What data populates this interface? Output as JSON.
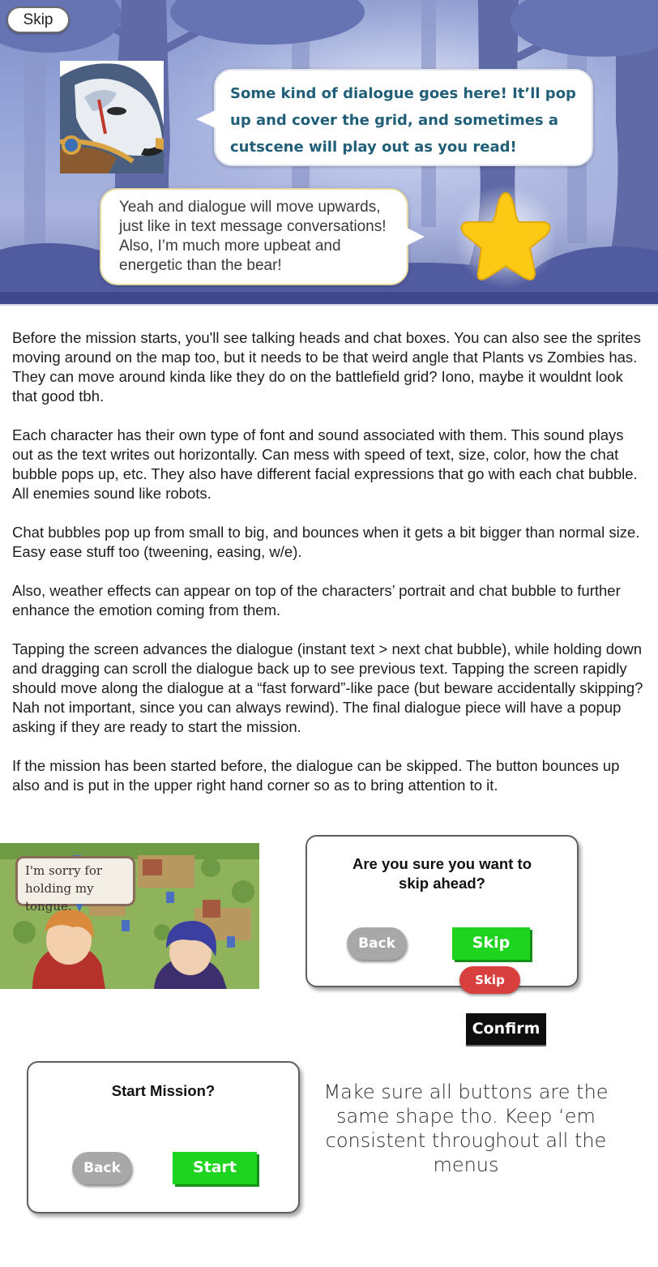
{
  "hero": {
    "skip_label": "Skip",
    "bear_line": "Some kind of dialogue goes here!  It’ll pop up and cover the grid, and sometimes a cutscene will play out as you read!",
    "star_line": "Yeah and dialogue will move upwards, just like in text message conversations!  Also, I’m much more upbeat and energetic than the bear!",
    "colors": {
      "bear_text": "#215f78",
      "star_fill": "#fcc915"
    }
  },
  "body": {
    "paragraphs": [
      "Before the mission starts, you'll see talking heads and chat boxes.  You can also see the sprites moving around on the map too, but it needs to be that weird angle that Plants vs Zombies has.  They can move around kinda like they do on the battlefield grid?  Iono, maybe it wouldnt look that good tbh.",
      "Each character has their own type of font and sound associated with them.  This sound plays out as the text writes out horizontally.  Can mess with speed of text, size, color, how the chat bubble pops up, etc.  They also have different facial expressions that go with each chat bubble.  All enemies sound like robots.",
      "Chat bubbles pop up from small to big, and bounces when it gets a bit bigger than normal size.  Easy ease stuff too (tweening, easing, w/e).",
      "Also, weather effects can appear on top of the characters’ portrait and chat bubble to further enhance the emotion coming from them.",
      "Tapping the screen advances the dialogue (instant text > next chat bubble), while holding down and dragging can scroll the dialogue back up to see previous text.  Tapping the screen rapidly should move along the dialogue at a “fast forward”-like pace (but beware accidentally skipping?  Nah not important, since you can always rewind).  The final dialogue piece will have a popup asking if they are ready to start the mission.",
      "If the mission has been started before, the dialogue can be skipped. The button bounces up also and is put in the upper right hand corner so as to bring attention to it."
    ]
  },
  "game_screenshot": {
    "dialogue": "I'm sorry for holding my tongue."
  },
  "skip_dialog": {
    "title": "Are you sure you want to skip ahead?",
    "back_label": "Back",
    "skip_label": "Skip"
  },
  "alt_buttons": {
    "red_skip_label": "Skip",
    "confirm_label": "Confirm"
  },
  "start_dialog": {
    "title": "Start Mission?",
    "back_label": "Back",
    "start_label": "Start"
  },
  "note": "Make sure all buttons are the same shape tho.  Keep ‘em consistent throughout all the menus"
}
